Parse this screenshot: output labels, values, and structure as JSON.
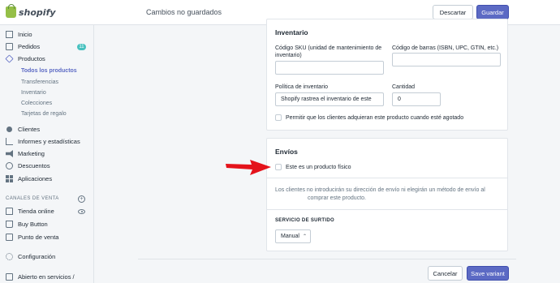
{
  "topbar": {
    "logo_text": "shopify",
    "status": "Cambios no guardados",
    "discard_label": "Descartar",
    "save_label": "Guardar"
  },
  "sidebar": {
    "items": [
      {
        "label": "Inicio",
        "icon": "home-icon"
      },
      {
        "label": "Pedidos",
        "icon": "orders-icon",
        "badge": "11"
      },
      {
        "label": "Productos",
        "icon": "products-icon"
      },
      {
        "label": "Clientes",
        "icon": "customers-icon"
      },
      {
        "label": "Informes y estadísticas",
        "icon": "reports-icon"
      },
      {
        "label": "Marketing",
        "icon": "marketing-icon"
      },
      {
        "label": "Descuentos",
        "icon": "discounts-icon"
      },
      {
        "label": "Aplicaciones",
        "icon": "apps-icon"
      }
    ],
    "product_sub": [
      "Todos los productos",
      "Transferencias",
      "Inventario",
      "Colecciones",
      "Tarjetas de regalo"
    ],
    "sales_channels_label": "CANALES DE VENTA",
    "channels": [
      {
        "label": "Tienda online",
        "icon": "store-icon"
      },
      {
        "label": "Buy Button",
        "icon": "buy-button-icon"
      },
      {
        "label": "Punto de venta",
        "icon": "pos-icon"
      }
    ],
    "settings_label": "Configuración",
    "open_label": "Abierto en servicios /"
  },
  "inventory": {
    "title": "Inventario",
    "sku_label": "Código SKU (unidad de mantenimiento de inventario)",
    "sku_value": "",
    "barcode_label": "Código de barras (ISBN, UPC, GTIN, etc.)",
    "barcode_value": "",
    "policy_label": "Política de inventario",
    "policy_value": "Shopify rastrea el inventario de este",
    "quantity_label": "Cantidad",
    "quantity_value": "0",
    "oversell_label": "Permitir que los clientes adquieran este producto cuando esté agotado"
  },
  "shipping": {
    "title": "Envíos",
    "physical_label": "Este es un producto físico",
    "help_line1": "Los clientes no introducirán su dirección de envío ni elegirán un método de envío al",
    "help_line2": "comprar este producto.",
    "fulfillment_label": "SERVICIO DE SURTIDO",
    "fulfillment_value": "Manual"
  },
  "footer": {
    "cancel_label": "Cancelar",
    "save_variant_label": "Save variant"
  },
  "colors": {
    "accent": "#5c6ac4",
    "arrow": "#e4131b",
    "badge": "#47c1bf"
  }
}
